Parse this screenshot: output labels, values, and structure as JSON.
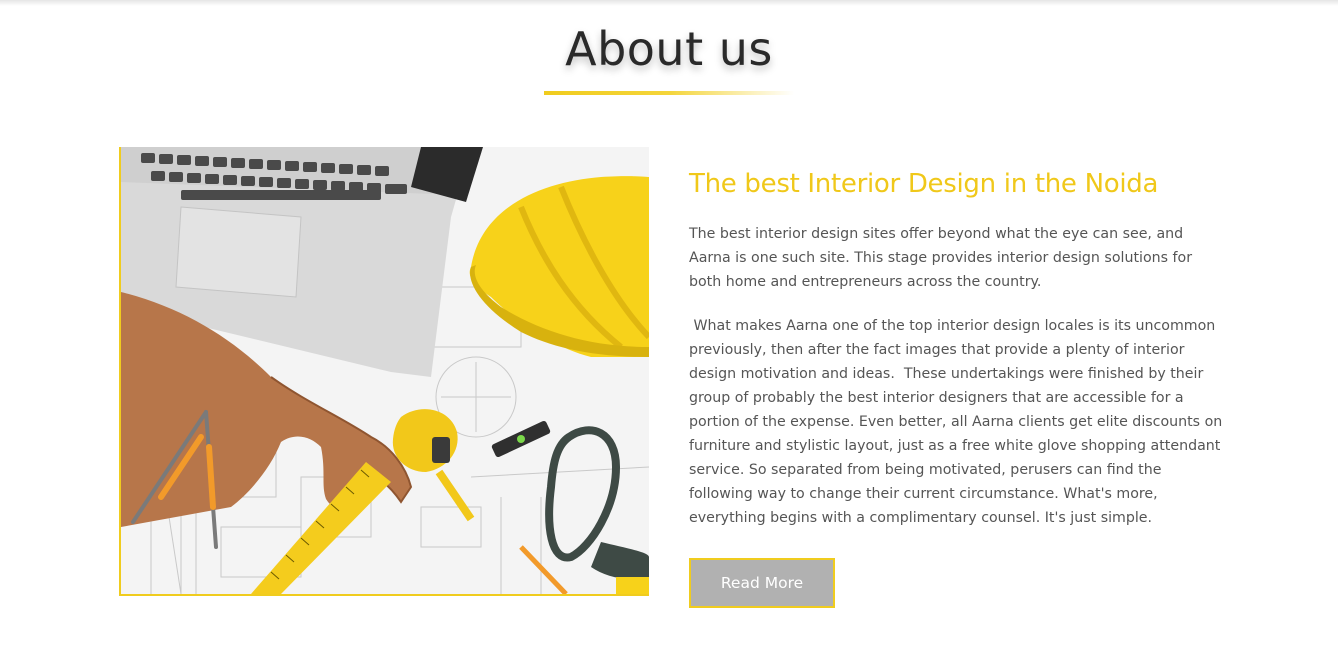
{
  "section": {
    "title": "About us"
  },
  "about": {
    "heading": "The best Interior Design in the Noida",
    "paragraph_1": "The best interior design sites offer beyond what the eye can see, and Aarna is one such site. This stage provides interior design solutions for both home and entrepreneurs across the country.",
    "paragraph_2": " What makes Aarna one of the top interior design locales is its uncommon previously, then after the fact images that provide a plenty of interior design motivation and ideas.  These undertakings were finished by their group of probably the best interior designers that are accessible for a portion of the expense. Even better, all Aarna clients get elite discounts on furniture and stylistic layout, just as a free white glove shopping attendant service. So separated from being motivated, perusers can find the following way to change their current circumstance. What's more, everything begins with a complimentary counsel. It's just simple.",
    "read_more_label": "Read More"
  },
  "colors": {
    "accent": "#f0cc1e",
    "title": "#2a2a2a",
    "body_text": "#555555",
    "button_bg": "#b1b1b1"
  },
  "image": {
    "subject": "architect workspace with laptop, yellow hard hat, tape measure, ruler, compass, level, safety glasses on blueprints"
  }
}
